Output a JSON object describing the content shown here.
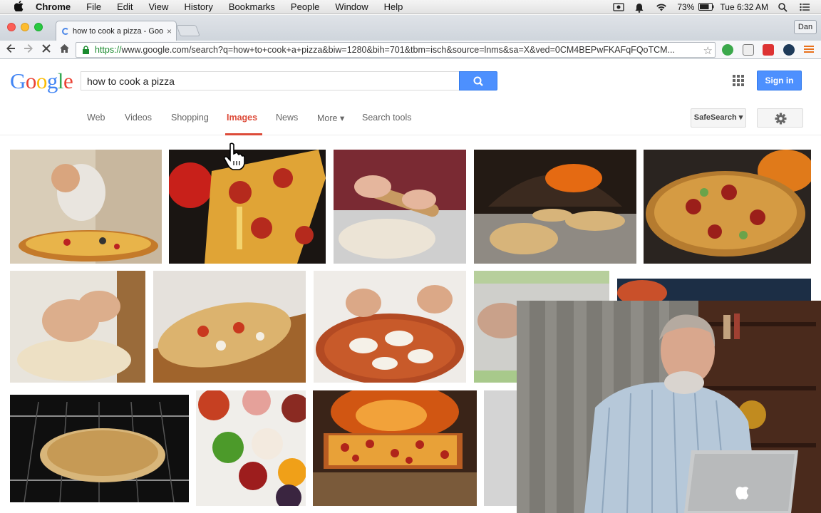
{
  "menubar": {
    "app_name": "Chrome",
    "items": [
      "File",
      "Edit",
      "View",
      "History",
      "Bookmarks",
      "People",
      "Window",
      "Help"
    ],
    "battery": "73%",
    "clock": "Tue 6:32 AM"
  },
  "tab": {
    "title": "how to cook a pizza - Goo",
    "close_glyph": "×"
  },
  "profile_name": "Dan",
  "omnibox": {
    "scheme": "https://",
    "rest": "www.google.com/search?q=how+to+cook+a+pizza&biw=1280&bih=701&tbm=isch&source=lnms&sa=X&ved=0CM4BEPwFKAFqFQoTCM..."
  },
  "google": {
    "logo_letters": [
      "G",
      "o",
      "o",
      "g",
      "l",
      "e"
    ],
    "query": "how to cook a pizza",
    "signin_label": "Sign in",
    "nav": {
      "web": "Web",
      "videos": "Videos",
      "shopping": "Shopping",
      "images": "Images",
      "news": "News",
      "more": "More ▾",
      "tools": "Search tools"
    },
    "safesearch_label": "SafeSearch ▾"
  },
  "colors": {
    "google_blue": "#4285f4",
    "google_red": "#ea4335",
    "google_yellow": "#fbbc05",
    "google_green": "#34a853",
    "active_tab_red": "#dd4b39",
    "button_blue": "#4d90fe"
  },
  "image_results": [
    "Chef topping a pizza",
    "Pepperoni pizza slice with cheese pull",
    "Rolling out pizza dough",
    "Pizzas in wood-fired oven",
    "Pepperoni and zucchini pizza",
    "Kneading dough",
    "Pizza on wooden board",
    "Adding mozzarella to pizza",
    "Hands over counter",
    "Pizza close-up",
    "Pizza baking in oven",
    "Bowls of toppings",
    "Pizza in brick oven",
    "Partial result"
  ],
  "webcam": {
    "description_icon": "presenter-video-icon"
  }
}
